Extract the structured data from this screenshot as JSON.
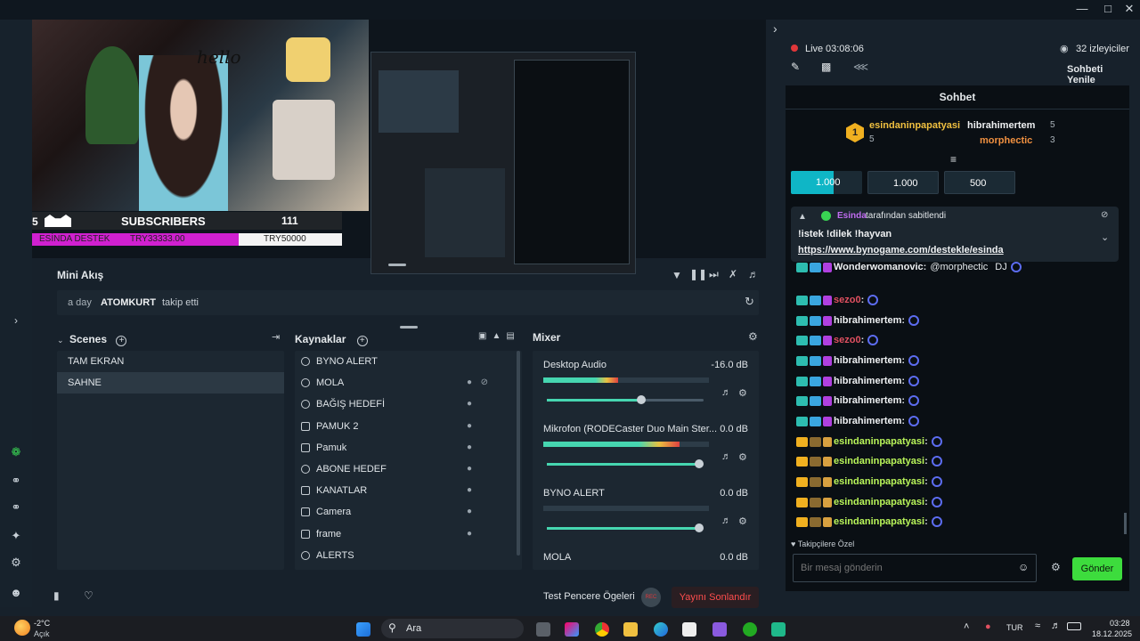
{
  "preview": {
    "subscribers_count_left": "5",
    "subscribers_label": "SUBSCRIBERS",
    "subscribers_goal": "111",
    "donation_label": "ESİNDA DESTEK",
    "donation_current": "TRY33333.00",
    "donation_goal": "TRY50000",
    "wall_text": "hello"
  },
  "mini_akis": {
    "title": "Mini Akış",
    "event_time": "a day",
    "event_user": "ATOMKURT",
    "event_action": "takip etti"
  },
  "scenes": {
    "title": "Scenes",
    "items": [
      "TAM EKRAN",
      "SAHNE"
    ],
    "selected": "SAHNE"
  },
  "sources": {
    "title": "Kaynaklar",
    "items": [
      "BYNO ALERT",
      "MOLA",
      "BAĞIŞ HEDEFİ",
      "PAMUK 2",
      "Pamuk",
      "ABONE HEDEF",
      "KANATLAR",
      "Camera",
      "frame",
      "ALERTS"
    ]
  },
  "mixer": {
    "title": "Mixer",
    "channels": [
      {
        "name": "Desktop Audio",
        "db": "-16.0 dB",
        "level": 0.45,
        "volume": 0.6
      },
      {
        "name": "Mikrofon (RODECaster Duo Main Ster...",
        "db": "0.0 dB",
        "level": 0.82,
        "volume": 0.97
      },
      {
        "name": "BYNO ALERT",
        "db": "0.0 dB",
        "level": 0,
        "volume": 0.97
      },
      {
        "name": "MOLA",
        "db": "0.0 dB",
        "level": 0,
        "volume": 0.97
      }
    ]
  },
  "bottom": {
    "test_label": "Test Pencere Ögeleri",
    "rec_label": "REC",
    "end_stream_label": "Yayını Sonlandır"
  },
  "chat_header": {
    "live_label": "Live",
    "live_time": "03:08:06",
    "viewers": "32 izleyiciler",
    "refresh_label": "Sohbeti Yenile",
    "chat_title": "Sohbet"
  },
  "leaderboard": {
    "first_rank": "1",
    "first_name": "esindaninpapatyasi",
    "first_count": "5",
    "second_name": "hibrahimertem",
    "second_count": "5",
    "third_name": "morphectic",
    "third_count": "3"
  },
  "points": [
    "1.000",
    "1.000",
    "500"
  ],
  "pinned": {
    "by_user": "Esinda",
    "by_suffix": "tarafından sabitlendi",
    "message": "!istek !dilek !hayvan",
    "link": "https://www.bynogame.com/destekle/esinda"
  },
  "chat_messages": [
    {
      "user": "Wonderwomanovic",
      "text": "@morphectic",
      "extra": "DJ",
      "color": "#eef0f2"
    },
    {
      "user": "sezo0",
      "text": "",
      "extra": "",
      "color": "#e05060"
    },
    {
      "user": "hibrahimertem",
      "text": "",
      "extra": "",
      "color": "#eef0f2"
    },
    {
      "user": "sezo0",
      "text": "",
      "extra": "",
      "color": "#e05060"
    },
    {
      "user": "hibrahimertem",
      "text": "",
      "extra": "",
      "color": "#eef0f2"
    },
    {
      "user": "hibrahimertem",
      "text": "",
      "extra": "",
      "color": "#eef0f2"
    },
    {
      "user": "hibrahimertem",
      "text": "",
      "extra": "",
      "color": "#eef0f2"
    },
    {
      "user": "hibrahimertem",
      "text": "",
      "extra": "",
      "color": "#eef0f2"
    },
    {
      "user": "esindaninpapatyasi",
      "text": "",
      "extra": "",
      "color": "#b9f55a"
    },
    {
      "user": "esindaninpapatyasi",
      "text": "",
      "extra": "",
      "color": "#b9f55a"
    },
    {
      "user": "esindaninpapatyasi",
      "text": "",
      "extra": "",
      "color": "#b9f55a"
    },
    {
      "user": "esindaninpapatyasi",
      "text": "",
      "extra": "",
      "color": "#b9f55a"
    },
    {
      "user": "esindaninpapatyasi",
      "text": "",
      "extra": "",
      "color": "#b9f55a"
    }
  ],
  "chat_footer": {
    "followers_only": "Takipçilere Özel",
    "placeholder": "Bir mesaj gönderin",
    "send_label": "Gönder"
  },
  "taskbar": {
    "weather_temp": "-2°C",
    "weather_desc": "Açık",
    "search_label": "Ara",
    "lang": "TUR",
    "time": "03:28",
    "date": "18.12.2025"
  },
  "colors": {
    "accent_green": "#39d353",
    "live_red": "#e0373a",
    "end_stream_red": "#ff4d4d",
    "send_green": "#3ddc3d",
    "donation_magenta": "#d020d0"
  }
}
